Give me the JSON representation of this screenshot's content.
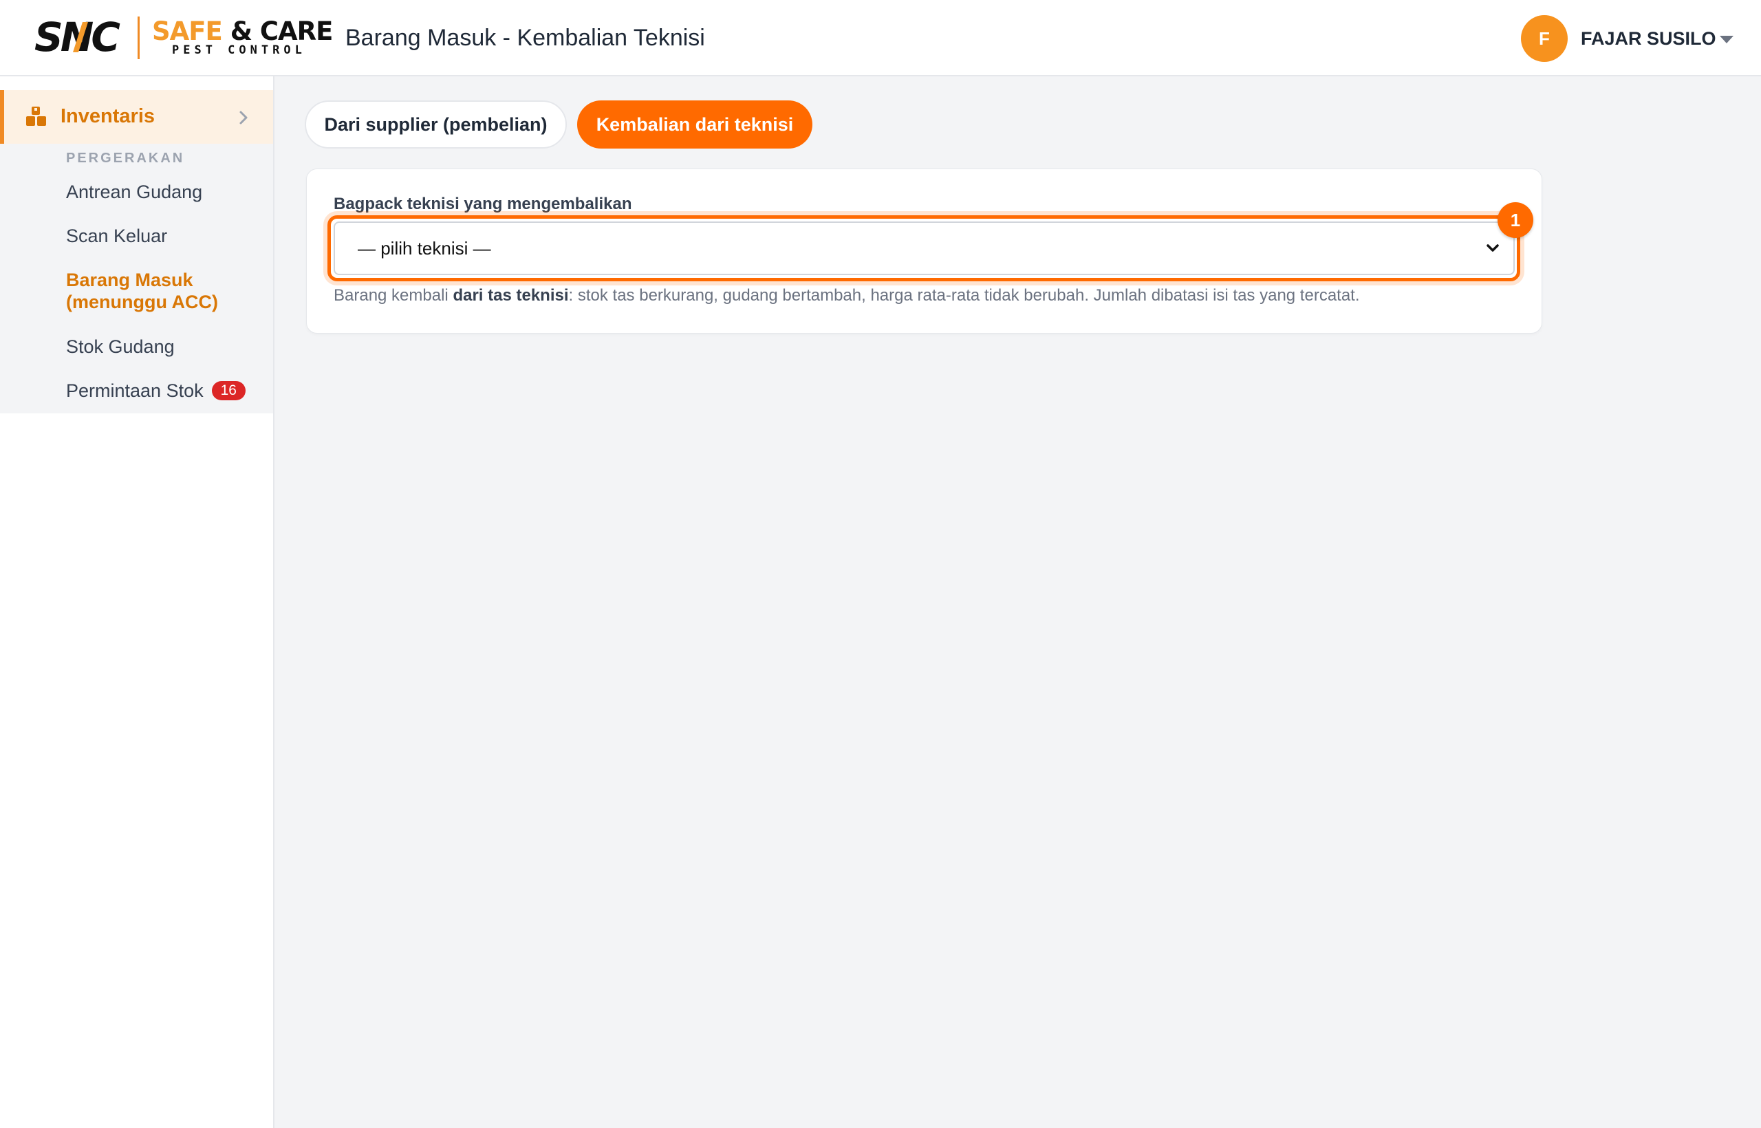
{
  "header": {
    "logo_snc": "SNC",
    "logo_brand_a": "SAFE",
    "logo_brand_b": "& CARE",
    "logo_sub": "PEST CONTROL",
    "page_title": "Barang Masuk - Kembalian Teknisi",
    "user_initial": "F",
    "user_name": "FAJAR SUSILO"
  },
  "sidebar": {
    "main_item": "Inventaris",
    "section_label": "PERGERAKAN",
    "items": [
      {
        "label": "Antrean Gudang"
      },
      {
        "label": "Scan Keluar"
      },
      {
        "label": "Barang Masuk",
        "label2": "(menunggu ACC)"
      },
      {
        "label": "Stok Gudang"
      },
      {
        "label": "Permintaan Stok",
        "badge": "16"
      }
    ]
  },
  "tabs": {
    "supplier": "Dari supplier (pembelian)",
    "teknisi": "Kembalian dari teknisi"
  },
  "form": {
    "label": "Bagpack teknisi yang mengembalikan",
    "select_value": "— pilih teknisi —",
    "marker": "1",
    "help_prefix": "Barang kembali ",
    "help_bold": "dari tas teknisi",
    "help_suffix": ": stok tas berkurang, gudang bertambah, harga rata-rata tidak berubah. Jumlah dibatasi isi tas yang tercatat."
  },
  "colors": {
    "accent": "#ff6a00",
    "brand_orange": "#f39a2b",
    "sidebar_active": "#d97706",
    "badge": "#dc2626"
  }
}
